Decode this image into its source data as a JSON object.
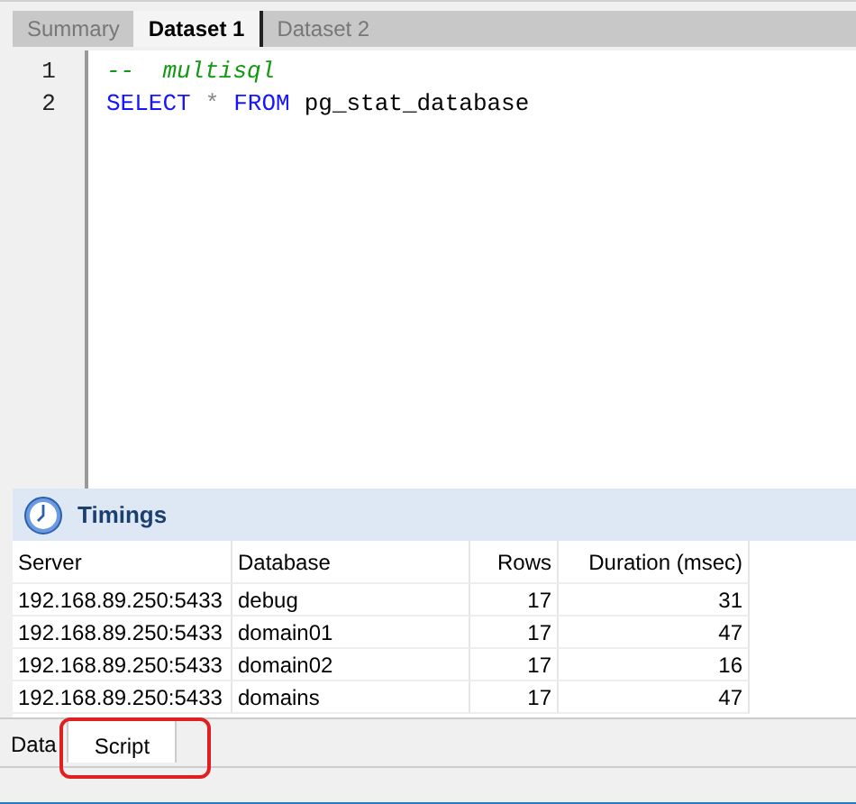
{
  "tabs": [
    {
      "label": "Summary",
      "selected": false
    },
    {
      "label": "Dataset 1",
      "selected": true
    },
    {
      "label": "Dataset 2",
      "selected": false
    }
  ],
  "editor": {
    "lines": [
      {
        "number": "1",
        "tokens": [
          {
            "kind": "comment",
            "text": "--  multisql"
          }
        ]
      },
      {
        "number": "2",
        "tokens": [
          {
            "kind": "keyword",
            "text": "SELECT"
          },
          {
            "kind": "operator",
            "text": "*"
          },
          {
            "kind": "keyword",
            "text": "FROM"
          },
          {
            "kind": "identifier",
            "text": "pg_stat_database"
          }
        ]
      }
    ]
  },
  "timings": {
    "title": "Timings",
    "columns": [
      "Server",
      "Database",
      "Rows",
      "Duration (msec)"
    ],
    "rows": [
      [
        "192.168.89.250:5433",
        "debug",
        "17",
        "31"
      ],
      [
        "192.168.89.250:5433",
        "domain01",
        "17",
        "47"
      ],
      [
        "192.168.89.250:5433",
        "domain02",
        "17",
        "16"
      ],
      [
        "192.168.89.250:5433",
        "domains",
        "17",
        "47"
      ]
    ]
  },
  "bottom_tabs": [
    {
      "label": "Data",
      "selected": false,
      "highlighted": false
    },
    {
      "label": "Script",
      "selected": true,
      "highlighted": true
    }
  ]
}
